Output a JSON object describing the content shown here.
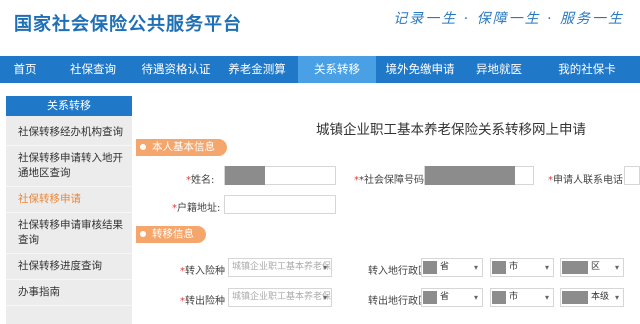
{
  "header": {
    "site_title": "国家社会保险公共服务平台",
    "slogan": "记录一生 · 保障一生 · 服务一生"
  },
  "nav": {
    "items": [
      {
        "label": "首页"
      },
      {
        "label": "社保查询"
      },
      {
        "label": "待遇资格认证"
      },
      {
        "label": "养老金测算"
      },
      {
        "label": "关系转移"
      },
      {
        "label": "境外免缴申请"
      },
      {
        "label": "异地就医"
      },
      {
        "label": "我的社保卡"
      }
    ],
    "active_index": 4
  },
  "sidebar": {
    "title": "关系转移",
    "items": [
      {
        "label": "社保转移经办机构查询"
      },
      {
        "label": "社保转移申请转入地开通地区查询"
      },
      {
        "label": "社保转移申请"
      },
      {
        "label": "社保转移申请审核结果查询"
      },
      {
        "label": "社保转移进度查询"
      },
      {
        "label": "办事指南"
      }
    ],
    "current_index": 2
  },
  "form": {
    "title": "城镇企业职工基本养老保险关系转移网上申请",
    "personal_section": "本人基本信息",
    "name_label": "姓名:",
    "ssn_label": "社会保障号码:",
    "phone_label": "申请人联系电话:",
    "household_label": "户籍地址:",
    "transfer_section": "转移信息",
    "in_insurance_label": "转入险种",
    "in_insurance_value": "城镇企业职工基本养老保险",
    "in_region_label": "转入地行政区",
    "out_insurance_label": "转出险种",
    "out_insurance_value": "城镇企业职工基本养老保险",
    "out_region_label": "转出地行政区",
    "province_suffix": "省",
    "city_suffix": "市",
    "district_suffix": "区",
    "out_district_suffix": "本级",
    "required_mark": "*"
  },
  "colors": {
    "brand_blue": "#1f78c8",
    "active_tab": "#4aa0e4",
    "section_orange": "#f5a66c",
    "current_item": "#e8893c"
  }
}
